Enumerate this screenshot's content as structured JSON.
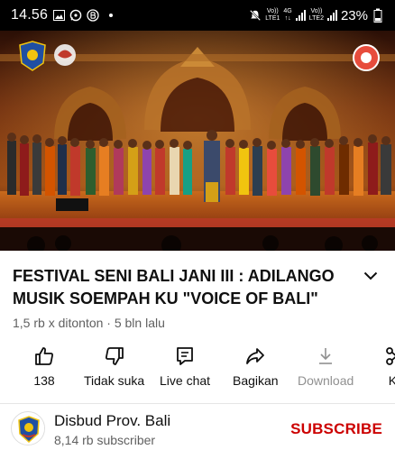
{
  "status_bar": {
    "time": "14.56",
    "net_top": "Vo))",
    "net_bottom": "LTE1",
    "net2_top": "4G",
    "net2_bottom": "",
    "net3_top": "Vo))",
    "net3_bottom": "LTE2",
    "battery": "23%",
    "icons": [
      "image-icon",
      "whatsapp-icon",
      "b-icon",
      "dot-icon",
      "mute-icon",
      "signal-icon",
      "battery-icon"
    ]
  },
  "video": {
    "icons": [
      "bali-crest-logo",
      "festival-logo",
      "tvri-logo"
    ]
  },
  "title": "FESTIVAL SENI BALI JANI III : ADILANGO MUSIK SOEMPAH KU \"VOICE OF BALI\"",
  "meta": "1,5 rb x ditonton · 5 bln lalu",
  "actions": {
    "like": "138",
    "dislike": "Tidak suka",
    "live_chat": "Live chat",
    "share": "Bagikan",
    "download": "Download",
    "clip": "Kl"
  },
  "channel": {
    "name": "Disbud Prov. Bali",
    "subscribers": "8,14 rb subscriber",
    "subscribe": "SUBSCRIBE"
  },
  "colors": {
    "subscribe": "#cc0000",
    "secondary_text": "#606060"
  }
}
